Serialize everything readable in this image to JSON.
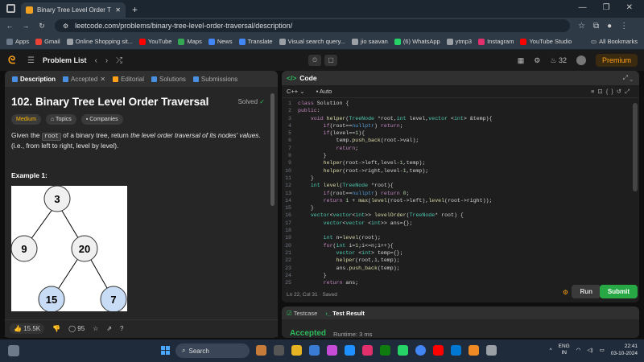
{
  "browser": {
    "tab_title": "Binary Tree Level Order Travers",
    "new_tab": "+",
    "url": "leetcode.com/problems/binary-tree-level-order-traversal/description/",
    "window_controls": [
      "—",
      "❐",
      "✕"
    ],
    "bookmarks": [
      {
        "label": "Apps",
        "color": "#6d7a8a"
      },
      {
        "label": "Gmail",
        "color": "#ea4335"
      },
      {
        "label": "Online Shopping sit...",
        "color": "#9aa0a6"
      },
      {
        "label": "YouTube",
        "color": "#ff0000"
      },
      {
        "label": "Maps",
        "color": "#34a853"
      },
      {
        "label": "News",
        "color": "#4285f4"
      },
      {
        "label": "Translate",
        "color": "#4285f4"
      },
      {
        "label": "Visual search query...",
        "color": "#9aa0a6"
      },
      {
        "label": "jio saavan",
        "color": "#9aa0a6"
      },
      {
        "label": "(6) WhatsApp",
        "color": "#25d366"
      },
      {
        "label": "ytmp3",
        "color": "#9aa0a6"
      },
      {
        "label": "Instagram",
        "color": "#e1306c"
      },
      {
        "label": "YouTube Studio",
        "color": "#ff0000"
      }
    ],
    "all_bookmarks": "All Bookmarks"
  },
  "header": {
    "problem_list": "Problem List",
    "streak": "32",
    "premium": "Premium"
  },
  "left": {
    "tabs": [
      {
        "label": "Description",
        "color": "#4a90e2"
      },
      {
        "label": "Accepted",
        "color": "#4a90e2"
      },
      {
        "label": "Editorial",
        "color": "#ffa116"
      },
      {
        "label": "Solutions",
        "color": "#4a90e2"
      },
      {
        "label": "Submissions",
        "color": "#4a90e2"
      }
    ],
    "title": "102. Binary Tree Level Order Traversal",
    "solved": "Solved",
    "difficulty": "Medium",
    "topics": "Topics",
    "companies": "Companies",
    "desc_part1": "Given the ",
    "desc_code": "root",
    "desc_part2": " of a binary tree, return ",
    "desc_italic": "the level order traversal of its nodes' values",
    "desc_part3": ". (i.e., from left to right, level by level).",
    "example_title": "Example 1:",
    "tree_nodes": [
      "3",
      "9",
      "20",
      "15",
      "7"
    ],
    "likes": "15.5K",
    "comments": "95"
  },
  "editor": {
    "title": "Code",
    "language": "C++",
    "autosave": "Auto",
    "status": "Ln 22, Col 31 · Saved",
    "run": "Run",
    "submit": "Submit",
    "lines": [
      {
        "n": "1",
        "t": "class Solution {"
      },
      {
        "n": "2",
        "t": "public:"
      },
      {
        "n": "3",
        "t": "    void helper(TreeNode *root,int level,vector <int> &temp){"
      },
      {
        "n": "4",
        "t": "        if(root==nullptr) return;"
      },
      {
        "n": "5",
        "t": "        if(level==1){"
      },
      {
        "n": "6",
        "t": "            temp.push_back(root->val);"
      },
      {
        "n": "7",
        "t": "            return;"
      },
      {
        "n": "8",
        "t": "        }"
      },
      {
        "n": "9",
        "t": "        helper(root->left,level-1,temp);"
      },
      {
        "n": "10",
        "t": "        helper(root->right,level-1,temp);"
      },
      {
        "n": "11",
        "t": "    }"
      },
      {
        "n": "12",
        "t": "    int level(TreeNode *root){"
      },
      {
        "n": "13",
        "t": "        if(root==nullptr) return 0;"
      },
      {
        "n": "14",
        "t": "        return 1 + max(level(root->left),level(root->right));"
      },
      {
        "n": "15",
        "t": "    }"
      },
      {
        "n": "16",
        "t": "    vector<vector<int>> levelOrder(TreeNode* root) {"
      },
      {
        "n": "17",
        "t": "        vector<vector <int>> ans={};"
      },
      {
        "n": "18",
        "t": ""
      },
      {
        "n": "19",
        "t": "        int n=level(root);"
      },
      {
        "n": "20",
        "t": "        for(int i=1;i<=n;i++){"
      },
      {
        "n": "21",
        "t": "            vector <int> temp={};"
      },
      {
        "n": "22",
        "t": "            helper(root,i,temp);"
      },
      {
        "n": "23",
        "t": "            ans.push_back(temp);"
      },
      {
        "n": "24",
        "t": "        }"
      },
      {
        "n": "25",
        "t": "        return ans;"
      }
    ]
  },
  "testpanel": {
    "testcase": "Testcase",
    "test_result": "Test Result",
    "accepted": "Accepted",
    "runtime": "Runtime: 3 ms"
  },
  "taskbar": {
    "search": "Search",
    "lang1": "ENG",
    "lang2": "IN",
    "time": "22:41",
    "date": "03-10-2024"
  }
}
